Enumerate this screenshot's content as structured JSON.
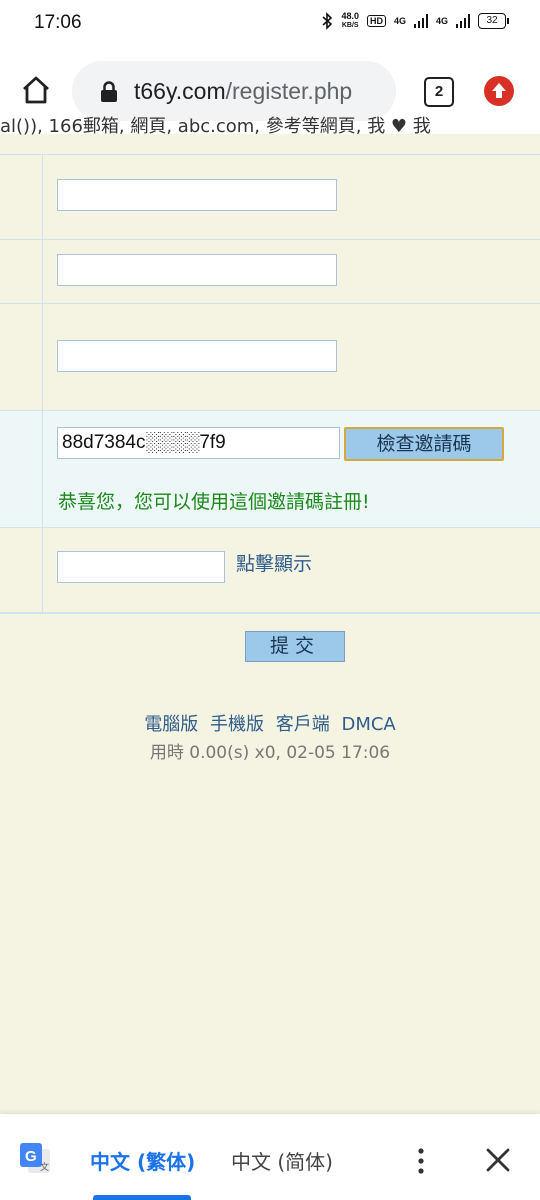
{
  "status_bar": {
    "time": "17:06",
    "net_speed_value": "48.0",
    "net_speed_unit": "KB/S",
    "hd_badge": "HD",
    "sig1": "4G",
    "sig2": "4G",
    "battery": "32"
  },
  "browser": {
    "url_domain": "t66y.com",
    "url_path": "/register.php",
    "tab_count": "2"
  },
  "page": {
    "partial_text": "al()), 166郵箱, 網頁, abc.com, 參考等網頁, 我 ♥ 我"
  },
  "form": {
    "field1_value": "",
    "field2_value": "",
    "field3_value": "",
    "invite_code_value": "88d7384c░░░░7f9",
    "check_button_label": "檢查邀請碼",
    "success_message": "恭喜您，您可以使用這個邀請碼註冊!",
    "captcha_value": "",
    "show_captcha_link": "點擊顯示",
    "submit_label": "提交"
  },
  "footer": {
    "links": [
      "電腦版",
      "手機版",
      "客戶端",
      "DMCA"
    ],
    "info": "用時 0.00(s) x0, 02-05 17:06"
  },
  "translate_bar": {
    "lang_selected": "中文 (繁体)",
    "lang_other": "中文 (简体)"
  },
  "colors": {
    "page_bg": "#f5f3e1",
    "accent": "#1a73e8",
    "success": "#1b8a1b",
    "button_bg": "#9cc9ea"
  }
}
